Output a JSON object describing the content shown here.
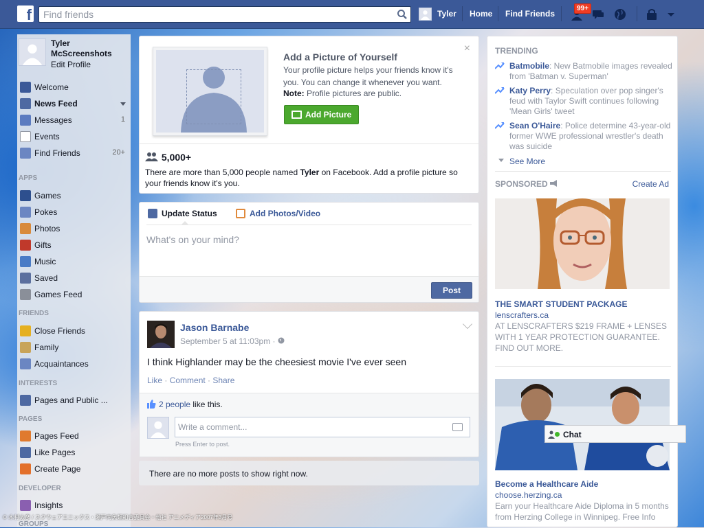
{
  "topbar": {
    "logo": "f",
    "search_placeholder": "Find friends",
    "user_name": "Tyler",
    "home": "Home",
    "find_friends": "Find Friends",
    "friend_requests_badge": "99+"
  },
  "profile": {
    "name": "Tyler McScreenshots",
    "edit": "Edit Profile"
  },
  "nav": {
    "main": [
      {
        "label": "Welcome",
        "count": "",
        "icon": "facebook-icon",
        "color": "#3b5998"
      },
      {
        "label": "News Feed",
        "count": "",
        "icon": "news-feed-icon",
        "color": "#4e69a2"
      },
      {
        "label": "Messages",
        "count": "1",
        "icon": "messages-icon",
        "color": "#5b7bc0"
      },
      {
        "label": "Events",
        "count": "",
        "icon": "calendar-icon",
        "color": "#ffffff"
      },
      {
        "label": "Find Friends",
        "count": "20+",
        "icon": "find-friends-icon",
        "color": "#6b86c2"
      }
    ],
    "apps_heading": "APPS",
    "apps": [
      {
        "label": "Games",
        "icon": "games-icon",
        "color": "#2d4f8e"
      },
      {
        "label": "Pokes",
        "icon": "pokes-icon",
        "color": "#6b86c2"
      },
      {
        "label": "Photos",
        "icon": "photos-icon",
        "color": "#d88a3c"
      },
      {
        "label": "Gifts",
        "icon": "gifts-icon",
        "color": "#c0392b"
      },
      {
        "label": "Music",
        "icon": "music-icon",
        "color": "#4a7bc6"
      },
      {
        "label": "Saved",
        "icon": "saved-icon",
        "color": "#5b6f9e"
      },
      {
        "label": "Games Feed",
        "icon": "games-feed-icon",
        "color": "#8a8f99"
      }
    ],
    "friends_heading": "FRIENDS",
    "friends": [
      {
        "label": "Close Friends",
        "icon": "star-icon",
        "color": "#e5b020"
      },
      {
        "label": "Family",
        "icon": "house-icon",
        "color": "#c8a45a"
      },
      {
        "label": "Acquaintances",
        "icon": "acquaintances-icon",
        "color": "#6b86c2"
      }
    ],
    "interests_heading": "INTERESTS",
    "interests": [
      {
        "label": "Pages and Public ...",
        "icon": "rss-icon",
        "color": "#4e69a2"
      }
    ],
    "pages_heading": "PAGES",
    "pages": [
      {
        "label": "Pages Feed",
        "icon": "megaphone-icon",
        "color": "#e07a2e"
      },
      {
        "label": "Like Pages",
        "icon": "thumbs-up-icon",
        "color": "#4e69a2"
      },
      {
        "label": "Create Page",
        "icon": "create-page-icon",
        "color": "#e3702b"
      }
    ],
    "developer_heading": "DEVELOPER",
    "developer": [
      {
        "label": "Insights",
        "icon": "insights-icon",
        "color": "#8a5fb0"
      }
    ],
    "groups_heading": "GROUPS"
  },
  "upload_prompt": {
    "title": "Add a Picture of Yourself",
    "desc": "Your profile picture helps your friends know it's you. You can change it whenever you want.",
    "note_label": "Note:",
    "note_text": " Profile pictures are public.",
    "button": "Add Picture",
    "close": "×",
    "count": "5,000+",
    "count_desc_1": "There are more than 5,000 people named ",
    "count_desc_name": "Tyler",
    "count_desc_2": " on Facebook. Add a profile picture so your friends know it's you."
  },
  "composer": {
    "tab_status": "Update Status",
    "tab_photos": "Add Photos/Video",
    "placeholder": "What's on your mind?",
    "post": "Post"
  },
  "story": {
    "author": "Jason Barnabe",
    "time": "September 5 at 11:03pm",
    "privacy_sep": " · ",
    "text": "I think Highlander may be the cheesiest movie I've ever seen",
    "like": "Like",
    "comment": "Comment",
    "share": "Share",
    "dot": " · ",
    "likes_link": "2 people",
    "likes_tail": " like this.",
    "comment_placeholder": "Write a comment...",
    "comment_hint": "Press Enter to post."
  },
  "no_more": "There are no more posts to show right now.",
  "trending": {
    "heading": "TRENDING",
    "items": [
      {
        "topic": "Batmobile",
        "text": ": New Batmobile images revealed from 'Batman v. Superman'"
      },
      {
        "topic": "Katy Perry",
        "text": ": Speculation over pop singer's feud with Taylor Swift continues following 'Mean Girls' tweet"
      },
      {
        "topic": "Sean O'Haire",
        "text": ": Police determine 43-year-old former WWE professional wrestler's death was suicide"
      }
    ],
    "see_more": "See More"
  },
  "sponsored": {
    "heading": "SPONSORED",
    "create_ad": "Create Ad",
    "ads": [
      {
        "title": "THE SMART STUDENT PACKAGE",
        "domain": "lenscrafters.ca",
        "body": "AT LENSCRAFTERS $219 FRAME + LENSES WITH 1 YEAR PROTECTION GUARANTEE. FIND OUT MORE."
      },
      {
        "title": "Become a Healthcare Aide",
        "domain": "choose.herzing.ca",
        "body": "Earn your Healthcare Aide Diploma in 5 months from Herzing College in Winnipeg. Free Info"
      }
    ]
  },
  "chat": {
    "label": "Chat"
  },
  "copyright": "© 木村太彦 / スクウェアエニックス・瀬戸内魚類組合委員会・他社 アニメディア2007年3月号"
}
